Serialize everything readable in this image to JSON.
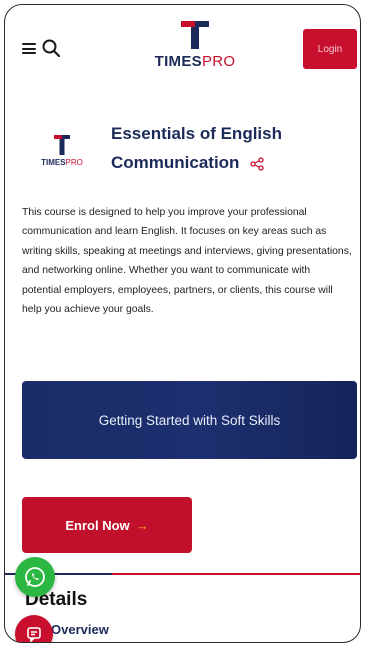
{
  "header": {
    "brand_part1": "TIMES",
    "brand_part2": "PRO",
    "login_label": "Login",
    "menu_icon": "menu-icon",
    "search_icon": "search-icon"
  },
  "course": {
    "logo_part1": "TIMES",
    "logo_part2": "PRO",
    "title_line1": "Essentials of English",
    "title_line2": "Communication",
    "share_icon": "share-icon",
    "description": "This course is designed to help you improve your professional communication and learn English. It focuses on key areas such as writing skills, speaking at meetings and interviews, giving presentations, and networking online. Whether you want to communicate with potential employers, employees, partners, or clients, this course will help you achieve your goals."
  },
  "cta": {
    "soft_skills_label": "Getting Started with Soft Skills",
    "enrol_label": "Enrol Now",
    "enrol_arrow": "→"
  },
  "details": {
    "title": "Details",
    "overview_label": "Overview"
  },
  "colors": {
    "brand_navy": "#1c2a5a",
    "brand_red": "#c8102e",
    "whatsapp_green": "#2bb741"
  }
}
